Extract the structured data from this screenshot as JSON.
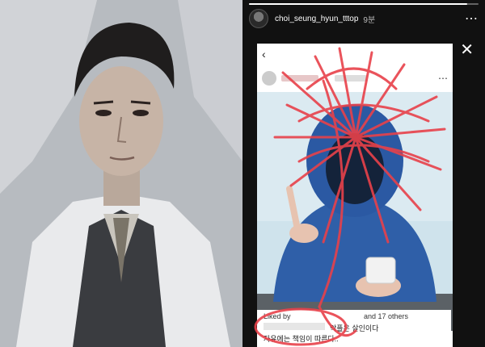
{
  "story": {
    "username": "choi_seung_hyun_tttop",
    "time": "9분",
    "progress": 0.95
  },
  "icons": {
    "more": "⋯",
    "close": "✕",
    "back": "‹",
    "photo_more": "⋯",
    "heart": "♥",
    "comment": "◯",
    "share": "➢",
    "bookmark": "⌑"
  },
  "post": {
    "liked_by": "Liked by",
    "others": "and 17 others",
    "caption_line1": "악플은 살인이다",
    "caption_line2": "자유에는 책임이 따른다.."
  },
  "colors": {
    "scribble": "#e8414a",
    "heart": "#e0245e"
  }
}
